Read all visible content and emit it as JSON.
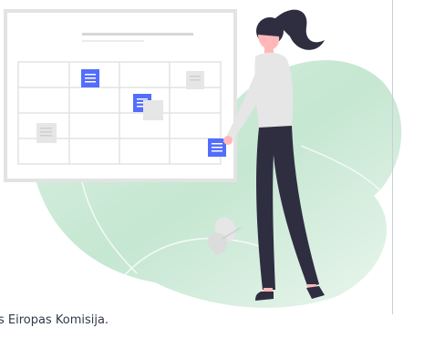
{
  "illustration": {
    "alt_icon": "woman-arranging-sticky-notes-on-board-illustration",
    "colors": {
      "blob": "#cfe9d6",
      "board_border": "#e3e3e3",
      "note": "#536dfe",
      "hair": "#2f2e41",
      "sweater": "#e6e6e6",
      "pants": "#2f2e41",
      "skin": "#ffb8b8",
      "plant": "#e6e6e6"
    }
  },
  "footer": {
    "caption": "s Eiropas Komisija."
  }
}
